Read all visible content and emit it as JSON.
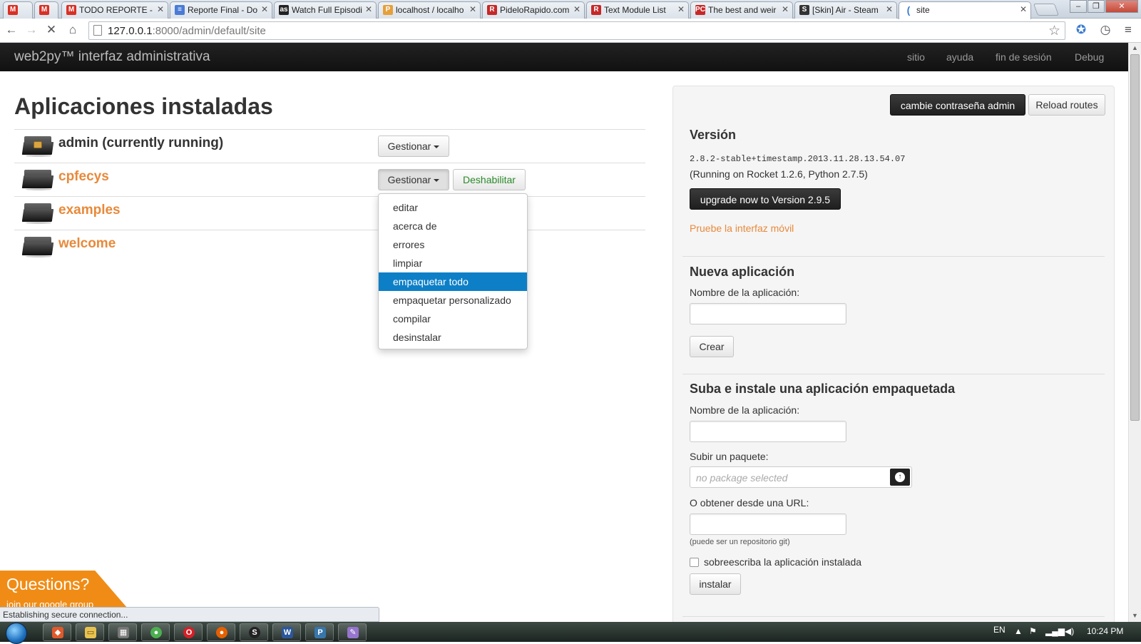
{
  "browser": {
    "tabs": [
      {
        "label": "",
        "icon": "gmail-100-icon",
        "color": "#d93025"
      },
      {
        "label": "",
        "icon": "gmail-icon",
        "color": "#d93025"
      },
      {
        "label": "TODO REPORTE -",
        "icon": "gmail-icon",
        "color": "#d93025"
      },
      {
        "label": "Reporte Final - Do",
        "icon": "docs-icon",
        "color": "#4a7bd6"
      },
      {
        "label": "Watch Full Episodi",
        "icon": "as-icon",
        "color": "#222222"
      },
      {
        "label": "localhost / localho",
        "icon": "phpmyadmin-icon",
        "color": "#e6a03a"
      },
      {
        "label": "PideloRapido.com",
        "icon": "pr-icon",
        "color": "#c62828"
      },
      {
        "label": "Text Module List",
        "icon": "pr-icon",
        "color": "#c62828"
      },
      {
        "label": "The best and weir",
        "icon": "pc-icon",
        "color": "#c62828"
      },
      {
        "label": "[Skin] Air - Steam",
        "icon": "steam-icon",
        "color": "#333333"
      },
      {
        "label": "site",
        "icon": "loading-icon",
        "color": "#3b7bd0"
      }
    ],
    "url_host": "127.0.0.1",
    "url_path": ":8000/admin/default/site"
  },
  "navbar": {
    "brand": "web2py™ interfaz administrativa",
    "links": [
      "sitio",
      "ayuda",
      "fin de sesión",
      "Debug"
    ]
  },
  "main": {
    "title": "Aplicaciones instaladas",
    "apps": [
      {
        "name": "admin (currently running)",
        "manage": "Gestionar"
      },
      {
        "name": "cpfecys",
        "manage": "Gestionar",
        "disable": "Deshabilitar"
      },
      {
        "name": "examples"
      },
      {
        "name": "welcome"
      }
    ],
    "dropdown": [
      "editar",
      "acerca de",
      "errores",
      "limpiar",
      "empaquetar todo",
      "empaquetar personalizado",
      "compilar",
      "desinstalar"
    ],
    "dropdown_selected": "empaquetar todo"
  },
  "panel": {
    "change_password": "cambie contraseña admin",
    "reload_routes": "Reload routes",
    "version_title": "Versión",
    "version_string": "2.8.2-stable+timestamp.2013.11.28.13.54.07",
    "running_on": "(Running on Rocket 1.2.6, Python 2.7.5)",
    "upgrade": "upgrade now to Version 2.9.5",
    "mobile_link": "Pruebe la interfaz móvil",
    "new_app_title": "Nueva aplicación",
    "new_app_label": "Nombre de la aplicación:",
    "create": "Crear",
    "upload_title": "Suba e instale una aplicación empaquetada",
    "upload_name_label": "Nombre de la aplicación:",
    "upload_pkg_label": "Subir un paquete:",
    "upload_pkg_placeholder": "no package selected",
    "url_label": "O obtener desde una URL:",
    "url_hint": "(puede ser un repositorio git)",
    "overwrite_label": "sobreescriba la aplicación instalada",
    "install": "instalar"
  },
  "overlay": {
    "questions": "Questions?",
    "questions_sub": "join our google group",
    "status": "Establishing secure connection..."
  },
  "taskbar": {
    "lang": "EN",
    "time": "10:24 PM",
    "apps": [
      "git-icon",
      "folder-icon",
      "calculator-icon",
      "chrome-icon",
      "opera-icon",
      "firefox-icon",
      "steam-icon",
      "word-icon",
      "python-icon",
      "paint-icon"
    ]
  }
}
